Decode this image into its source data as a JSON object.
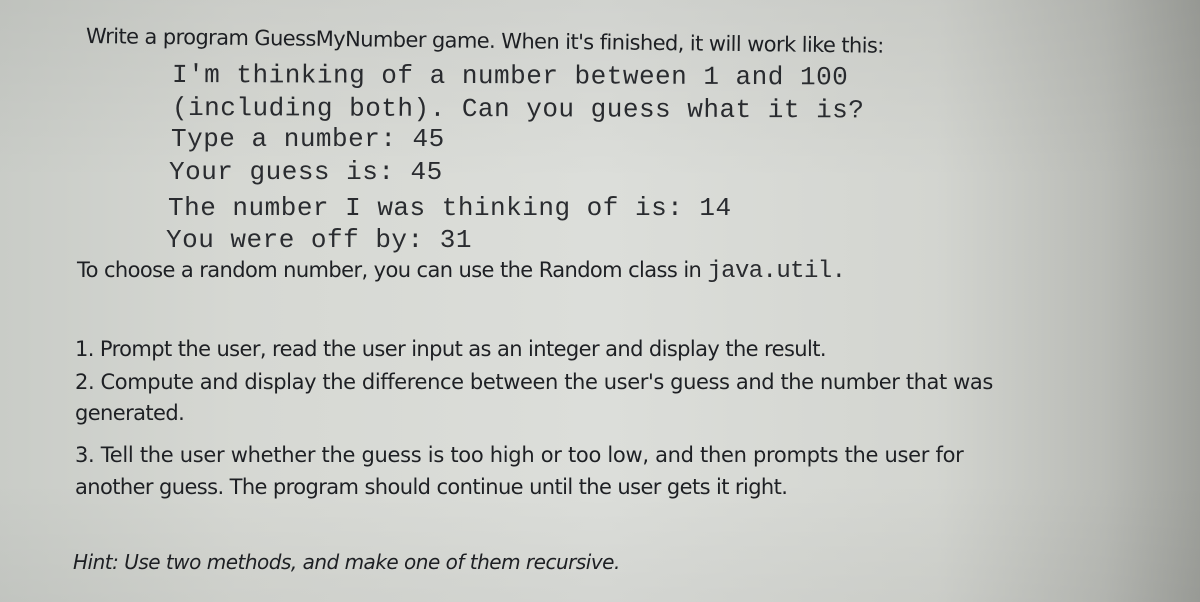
{
  "intro": "Write a program GuessMyNumber game. When it's finished, it will work like this:",
  "sample_output": [
    "I'm thinking of a number between 1 and 100",
    "(including both). Can you guess what it is?",
    "Type a number: 45",
    "Your guess is: 45",
    "The number I was thinking of is: 14",
    "You were off by: 31"
  ],
  "random_note": {
    "text": "To choose a random number, you can use the Random class in ",
    "code": "java.util."
  },
  "steps": [
    "1. Prompt the user, read the user input as an integer and display the result.",
    "2. Compute and display the difference between the user's guess and the number that was",
    "generated.",
    "3. Tell the user whether the guess is too high or too low, and then prompts the user for",
    "another guess. The program should continue until the user gets it right."
  ],
  "hint": "Hint: Use two methods, and make one of them recursive."
}
